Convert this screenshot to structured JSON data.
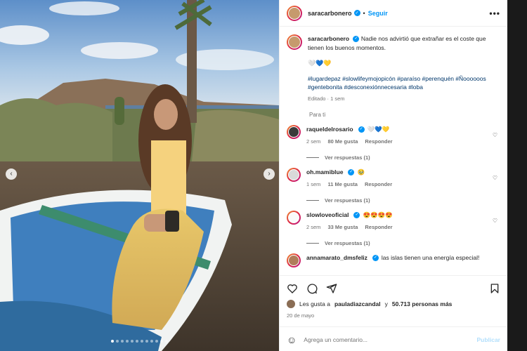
{
  "post": {
    "username": "saracarbonero",
    "follow_label": "Seguir",
    "separator": "•",
    "more_label": "•••"
  },
  "caption": {
    "username": "saracarbonero",
    "text": "Nadie nos advirtió que extrañar es el coste que tienen los buenos momentos.",
    "emojis": "🤍💙💛",
    "hashtags": "#lugardepaz #slowlifeymojopicón #paraíso #perenquén #Ñoooooos #gentebonita #desconexiónnecesaria #loba",
    "edited": "Editado",
    "time": "1 sem"
  },
  "section_label": "Para ti",
  "comments": [
    {
      "username": "raqueldelrosario",
      "text": "🤍💙💛",
      "time": "2 sem",
      "likes": "80 Me gusta",
      "reply": "Responder",
      "replies": "Ver respuestas (1)"
    },
    {
      "username": "oh.mamiblue",
      "text": "🥹",
      "time": "1 sem",
      "likes": "11 Me gusta",
      "reply": "Responder",
      "replies": "Ver respuestas (1)"
    },
    {
      "username": "slowloveoficial",
      "text": "😍😍😍😍",
      "time": "2 sem",
      "likes": "33 Me gusta",
      "reply": "Responder",
      "replies": "Ver respuestas (1)"
    },
    {
      "username": "annamarato_dmsfeliz",
      "text": "las islas tienen una energía especial!",
      "time": "",
      "likes": "",
      "reply": "",
      "replies": ""
    }
  ],
  "likes_summary": {
    "prefix": "Les gusta a",
    "user": "pauladiazcandal",
    "middle": "y",
    "count": "50.713 personas más"
  },
  "date": "20 de mayo",
  "comment_box": {
    "placeholder": "Agrega un comentario...",
    "publish_label": "Publicar"
  },
  "carousel": {
    "total": 12,
    "active_index": 0
  }
}
